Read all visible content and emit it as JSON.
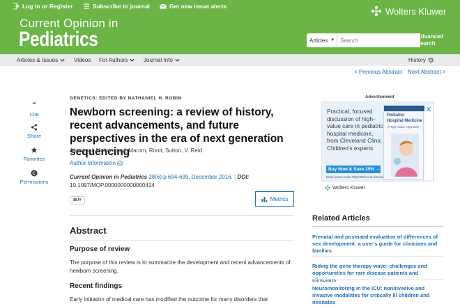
{
  "header": {
    "links": [
      {
        "icon": "login-icon",
        "label": "Log in or Register"
      },
      {
        "icon": "list-icon",
        "label": "Subscribe to journal"
      },
      {
        "icon": "mail-icon",
        "label": "Get new issue alerts"
      }
    ],
    "brand_top": "Current Opinion in",
    "brand_main": "Pediatrics",
    "publisher": "Wolters Kluwer",
    "search": {
      "scope": "Articles",
      "placeholder": "Search"
    },
    "advanced_search": "Advanced Search"
  },
  "nav": {
    "items": [
      {
        "label": "Articles & Issues",
        "has_dropdown": true
      },
      {
        "label": "Videos",
        "has_dropdown": false
      },
      {
        "label": "For Authors",
        "has_dropdown": true
      },
      {
        "label": "Journal Info",
        "has_dropdown": true
      }
    ],
    "history": "History"
  },
  "pager": {
    "prev": "< Previous Abstract",
    "next": "Next Abstract >"
  },
  "rail": [
    {
      "icon": "quote-icon",
      "label": "Cite"
    },
    {
      "icon": "share-icon",
      "label": "Share"
    },
    {
      "icon": "star-icon",
      "label": "Favorites"
    },
    {
      "icon": "copyright-icon",
      "label": "Permissions"
    }
  ],
  "article": {
    "overline": "GENETICS: EDITED BY NATHANIEL H. ROBIN",
    "title": "Newborn screening: a review of history, recent advancements, and future perspectives in the era of next generation sequencing",
    "authors": "Almannai, Mohammed; Marom, Ronit; Sutton, V. Reid",
    "author_info": "Author Information",
    "journal": "Current Opinion in Pediatrics",
    "volume": "28(6):p 694-699, December 2016.",
    "doi_label": "DOI:",
    "doi": "10.1097/MOP.0000000000000414",
    "buy": "BUY",
    "metrics": "Metrics"
  },
  "abstract": {
    "heading": "Abstract",
    "sections": [
      {
        "heading": "Purpose of review",
        "text": "The purpose of this review is to summarize the development and recent advancements of newborn screening."
      },
      {
        "heading": "Recent findings",
        "text": "Early initiation of medical care has modified the outcome for many disorders that"
      }
    ]
  },
  "ad": {
    "label": "Advertisement",
    "text": "Practical, focused discussion of high-value care in pediatric hospital medicine, from Cleveland Clinic Children's experts",
    "button": "Buy Now & Save 25% →",
    "promo": "Enter promo code WQA001AA at checkout.",
    "book_title_1": "Pediatric",
    "book_title_2": "Hospital Medicine",
    "book_sub": "A High-Value Approach",
    "publisher": "Wolters Kluwer"
  },
  "related": {
    "heading": "Related Articles",
    "items": [
      "Prenatal and postnatal evaluation of differences of sex development: a user's guide for clinicians and families",
      "Riding the gene therapy wave: challenges and opportunities for rare disease patients and clinicians",
      "Neuromonitoring in the ICU: noninvasive and invasive modalities for critically ill children and neonates"
    ]
  },
  "colors": {
    "header_green": "#6ab546",
    "link_blue": "#1e6fb3",
    "nav_gray": "#ebebeb"
  }
}
